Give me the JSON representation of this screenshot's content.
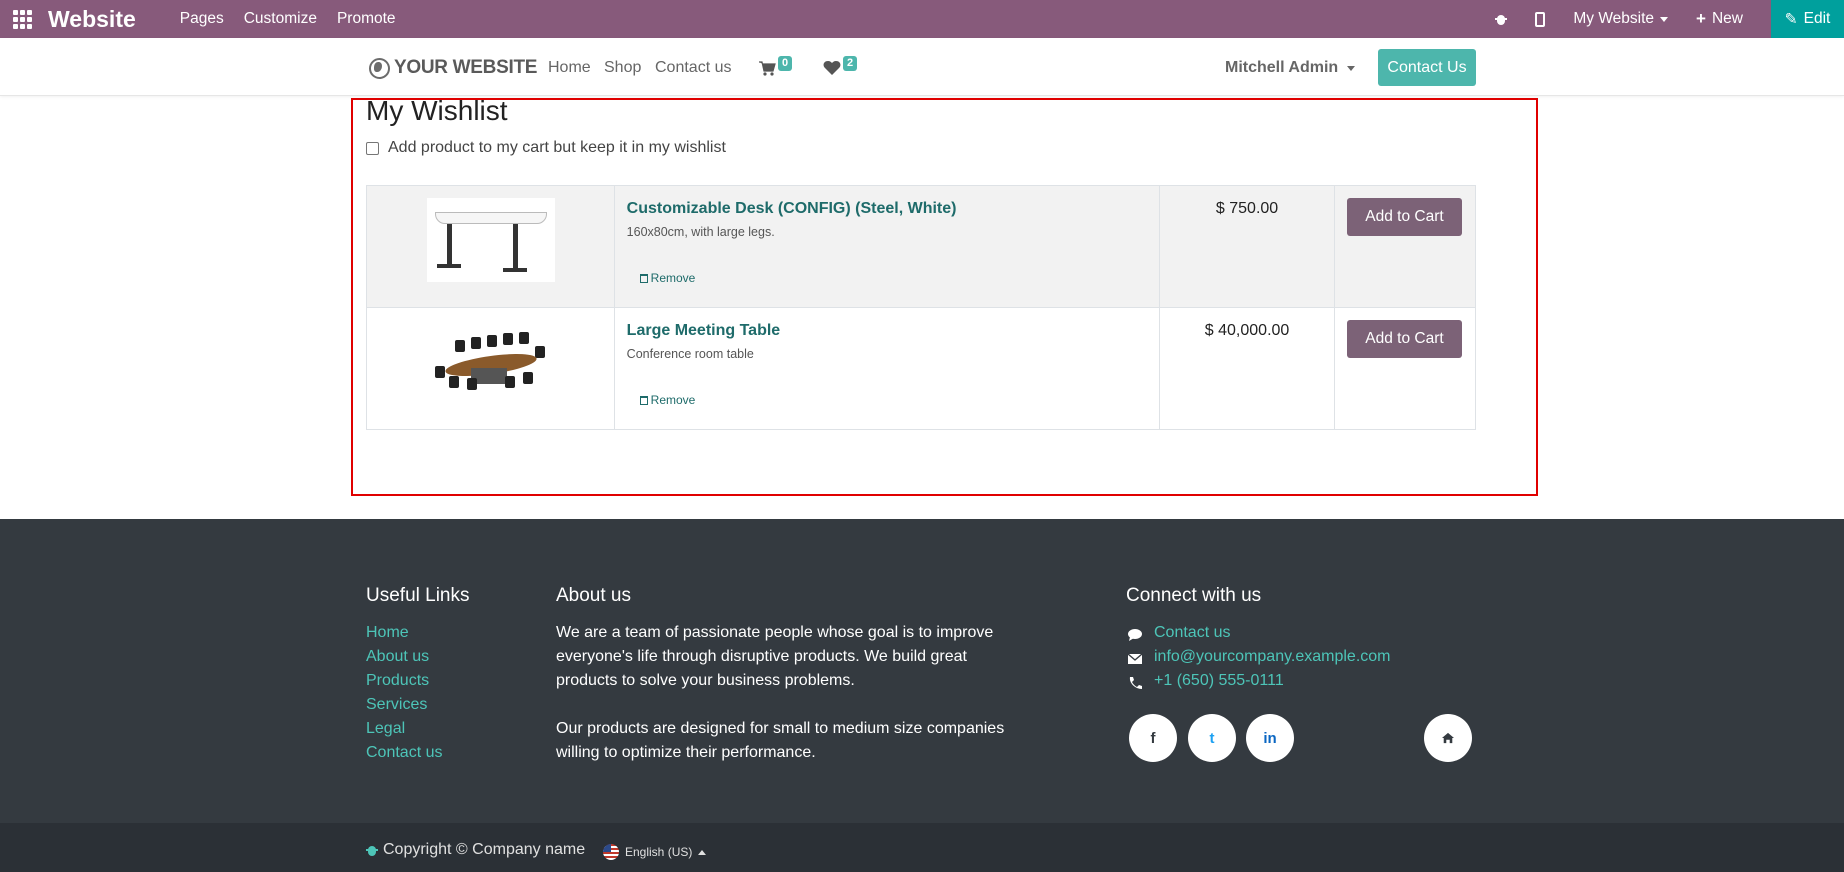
{
  "adminbar": {
    "brand": "Website",
    "menu": [
      "Pages",
      "Customize",
      "Promote"
    ],
    "site_selector": "My Website",
    "new_label": "New",
    "edit_label": "Edit",
    "colors": {
      "bar": "#875a7b",
      "edit": "#00a09d"
    }
  },
  "header": {
    "logo_text": "YOUR WEBSITE",
    "nav": [
      "Home",
      "Shop",
      "Contact us"
    ],
    "cart_count": "0",
    "wishlist_count": "2",
    "user": "Mitchell Admin",
    "contact_button": "Contact Us"
  },
  "wishlist": {
    "title": "My Wishlist",
    "keep_option": "Add product to my cart but keep it in my wishlist",
    "items": [
      {
        "name": "Customizable Desk (CONFIG) (Steel, White)",
        "description": "160x80cm, with large legs.",
        "price": "$ 750.00",
        "remove_label": "Remove",
        "add_label": "Add to Cart"
      },
      {
        "name": "Large Meeting Table",
        "description": "Conference room table",
        "price": "$ 40,000.00",
        "remove_label": "Remove",
        "add_label": "Add to Cart"
      }
    ]
  },
  "footer": {
    "useful_links_title": "Useful Links",
    "useful_links": [
      "Home",
      "About us",
      "Products",
      "Services",
      "Legal",
      "Contact us"
    ],
    "about_title": "About us",
    "about_p1": "We are a team of passionate people whose goal is to improve everyone's life through disruptive products. We build great products to solve your business problems.",
    "about_p2": "Our products are designed for small to medium size companies willing to optimize their performance.",
    "connect_title": "Connect with us",
    "contact_link": "Contact us",
    "email": "info@yourcompany.example.com",
    "phone": "+1 (650) 555-0111",
    "social": [
      "f",
      "t",
      "in"
    ],
    "copyright": "Copyright © Company name",
    "language": "English (US)"
  }
}
